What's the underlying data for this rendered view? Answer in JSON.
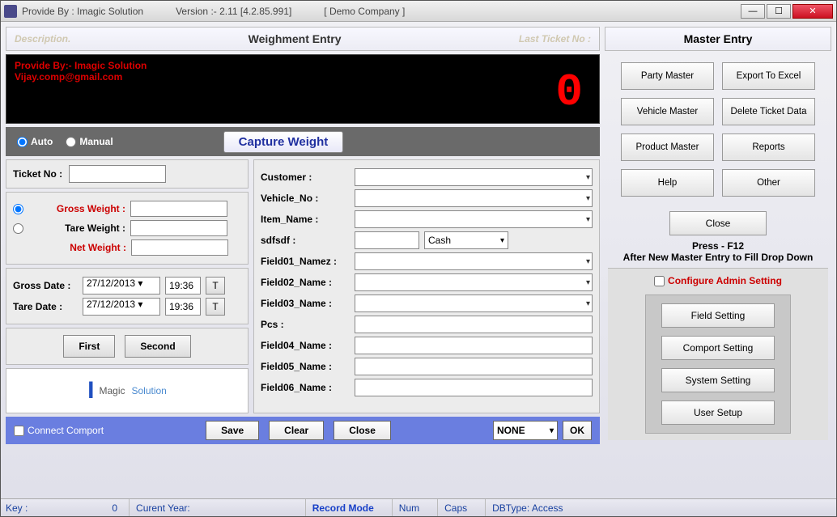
{
  "titlebar": {
    "provide": "Provide By : Imagic Solution",
    "version": "Version :- 2.11 [4.2.85.991]",
    "company": "[ Demo Company ]"
  },
  "header": {
    "desc": "Description.",
    "title": "Weighment Entry",
    "last": "Last Ticket No :"
  },
  "display": {
    "line1": "Provide By:- Imagic Solution",
    "line2": "Vijay.comp@gmail.com",
    "value": "0"
  },
  "mode": {
    "auto": "Auto",
    "manual": "Manual",
    "capture": "Capture Weight"
  },
  "ticket": {
    "label": "Ticket No :",
    "value": ""
  },
  "weights": {
    "gross": "Gross Weight :",
    "tare": "Tare Weight  :",
    "net": "Net Weight :",
    "gross_val": "",
    "tare_val": "",
    "net_val": ""
  },
  "dates": {
    "gross_label": "Gross Date :",
    "tare_label": "Tare Date :",
    "gross_date": "27/12/2013",
    "gross_time": "19:36",
    "tare_date": "27/12/2013",
    "tare_time": "19:36",
    "t": "T"
  },
  "fs": {
    "first": "First",
    "second": "Second"
  },
  "fields": {
    "customer": "Customer :",
    "vehicle": "Vehicle_No :",
    "item": "Item_Name :",
    "sdf": "sdfsdf :",
    "cash": "Cash",
    "f1": "Field01_Namez :",
    "f2": "Field02_Name :",
    "f3": "Field03_Name :",
    "pcs": "Pcs :",
    "f4": "Field04_Name :",
    "f5": "Field05_Name :",
    "f6": "Field06_Name :"
  },
  "bottom": {
    "connect": "Connect Comport",
    "save": "Save",
    "clear": "Clear",
    "close": "Close",
    "none": "NONE",
    "ok": "OK"
  },
  "master": {
    "title": "Master Entry",
    "party": "Party Master",
    "export": "Export To Excel",
    "vehicle": "Vehicle Master",
    "delete_ticket": "Delete Ticket Data",
    "product": "Product Master",
    "reports": "Reports",
    "help": "Help",
    "other": "Other",
    "close": "Close",
    "press": "Press - F12",
    "after": "After New Master Entry to Fill Drop Down",
    "configure": "Configure Admin Setting",
    "field_setting": "Field Setting",
    "comport_setting": "Comport Setting",
    "system_setting": "System Setting",
    "user_setup": "User Setup"
  },
  "status": {
    "key": "Key :",
    "keyval": "0",
    "year": "Curent Year:",
    "record": "Record Mode",
    "num": "Num",
    "caps": "Caps",
    "dbtype": "DBType: Access"
  }
}
